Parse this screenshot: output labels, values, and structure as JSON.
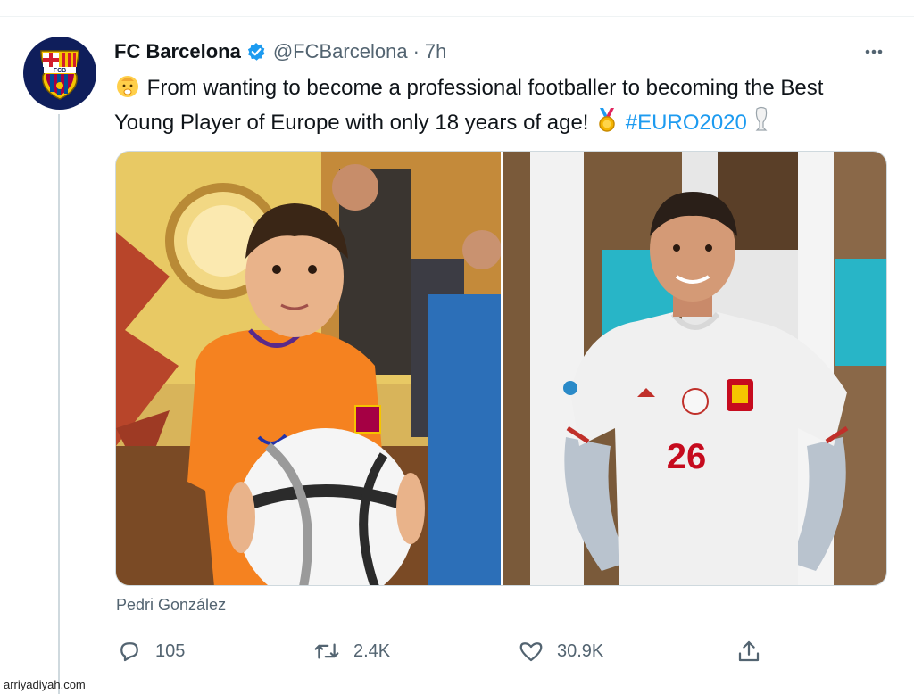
{
  "tweet": {
    "author_name": "FC Barcelona",
    "handle": "@FCBarcelona",
    "separator": "·",
    "time": "7h",
    "text_line1": " From wanting to become a professional footballer to becoming the Best",
    "text_line2_pre": "Young Player of Europe with only 18 years of age! ",
    "hashtag": "#EURO2020",
    "avatar_text": "FCB",
    "caption": "Pedri González",
    "jersey_number": "26"
  },
  "actions": {
    "reply_count": "105",
    "retweet_count": "2.4K",
    "like_count": "30.9K"
  },
  "icons": {
    "verified": "verified-badge-icon",
    "more": "more-options-icon",
    "reply": "reply-icon",
    "retweet": "retweet-icon",
    "like": "heart-icon",
    "share": "share-icon",
    "baby": "baby-emoji-icon",
    "medal": "medal-emoji-icon",
    "trophy": "trophy-emoji-icon"
  },
  "colors": {
    "accent": "#1d9bf0",
    "muted": "#536471",
    "text": "#0f1419"
  },
  "watermark": "arriyadiyah.com"
}
